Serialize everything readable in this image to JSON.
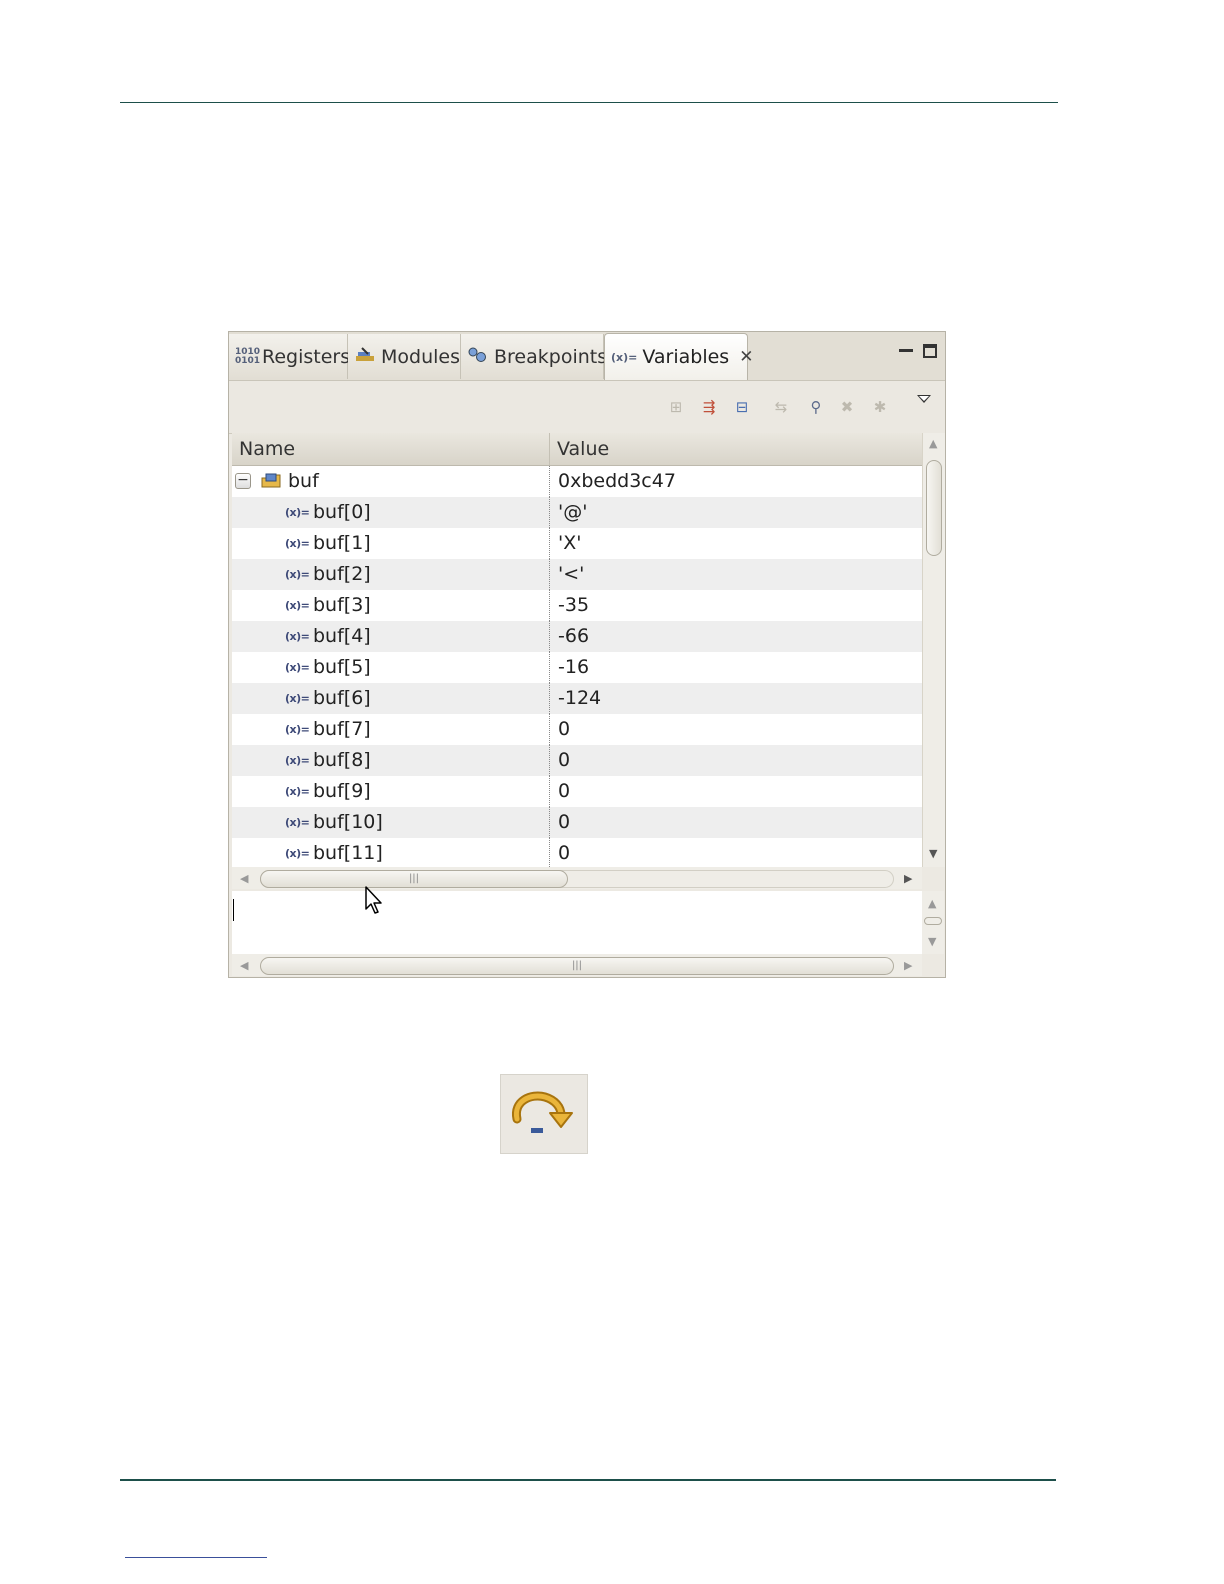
{
  "panel": {
    "tabs": [
      {
        "label": "Registers",
        "icon": "registers-icon"
      },
      {
        "label": "Modules",
        "icon": "modules-icon"
      },
      {
        "label": "Breakpoints",
        "icon": "breakpoints-icon"
      },
      {
        "label": "Variables",
        "icon": "variables-icon",
        "active": true
      }
    ],
    "columns": {
      "name": "Name",
      "value": "Value"
    },
    "root": {
      "name": "buf",
      "value": "0xbedd3c47",
      "expanded": true
    },
    "children": [
      {
        "name": "buf[0]",
        "value": "'@'"
      },
      {
        "name": "buf[1]",
        "value": "'X'"
      },
      {
        "name": "buf[2]",
        "value": "'<'"
      },
      {
        "name": "buf[3]",
        "value": "-35"
      },
      {
        "name": "buf[4]",
        "value": "-66"
      },
      {
        "name": "buf[5]",
        "value": "-16"
      },
      {
        "name": "buf[6]",
        "value": "-124"
      },
      {
        "name": "buf[7]",
        "value": "0"
      },
      {
        "name": "buf[8]",
        "value": "0"
      },
      {
        "name": "buf[9]",
        "value": "0"
      },
      {
        "name": "buf[10]",
        "value": "0"
      },
      {
        "name": "buf[11]",
        "value": "0"
      }
    ],
    "variable_icon_text": "(x)=",
    "registers_icon_text": "1010 0101"
  },
  "colors": {
    "rule": "#1d4f4a",
    "step_icon": "#e0a020"
  }
}
